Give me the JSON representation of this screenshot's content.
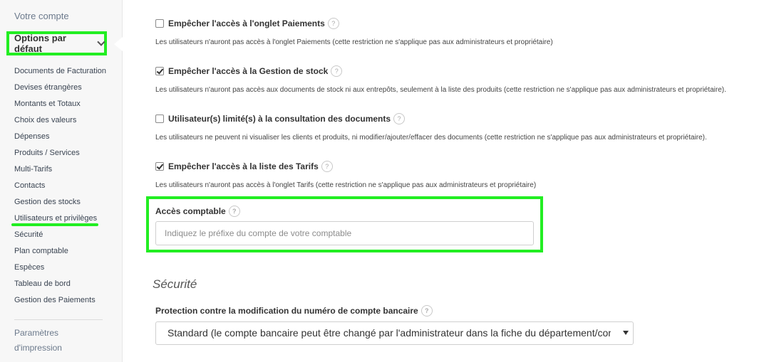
{
  "sidebar": {
    "top_link": "Votre compte",
    "current_section": "Options par défaut",
    "items": [
      "Documents de Facturation",
      "Devises étrangères",
      "Montants et Totaux",
      "Choix des valeurs",
      "Dépenses",
      "Produits / Services",
      "Multi-Tarifs",
      "Contacts",
      "Gestion des stocks",
      "Utilisateurs et privilèges",
      "Sécurité",
      "Plan comptable",
      "Espèces",
      "Tableau de bord",
      "Gestion des Paiements"
    ],
    "print_line1": "Paramètres",
    "print_line2": "d'impression"
  },
  "options": [
    {
      "label": "Empêcher l'accès à l'onglet Paiements",
      "checked": false,
      "desc": "Les utilisateurs n'auront pas accès à l'onglet Paiements (cette restriction ne s'applique pas aux administrateurs et propriétaire)"
    },
    {
      "label": "Empêcher l'accès à la Gestion de stock",
      "checked": true,
      "desc": "Les utilisateurs n'auront pas accès aux documents de stock ni aux entrepôts, seulement à la liste des produits (cette restriction ne s'applique pas aux administrateurs et propriétaire)."
    },
    {
      "label": "Utilisateur(s) limité(s) à la consultation des documents",
      "checked": false,
      "desc": "Les utilisateurs ne peuvent ni visualiser les clients et produits, ni modifier/ajouter/effacer des documents (cette restriction ne s'applique pas aux administrateurs et propriétaire)."
    },
    {
      "label": "Empêcher l'accès à la liste des Tarifs",
      "checked": true,
      "desc": "Les utilisateurs n'auront pas accès à l'onglet Tarifs (cette restriction ne s'applique pas aux administrateurs et propriétaire)"
    }
  ],
  "help_glyph": "?",
  "accounting": {
    "label": "Accès comptable",
    "placeholder": "Indiquez le préfixe du compte de votre comptable",
    "value": ""
  },
  "security": {
    "title": "Sécurité",
    "protection_label": "Protection contre la modification du numéro de compte bancaire",
    "protection_value": "Standard (le compte bancaire peut être changé par l'administrateur dans la fiche du département/compte)"
  },
  "highlight_color": "#22ee22"
}
